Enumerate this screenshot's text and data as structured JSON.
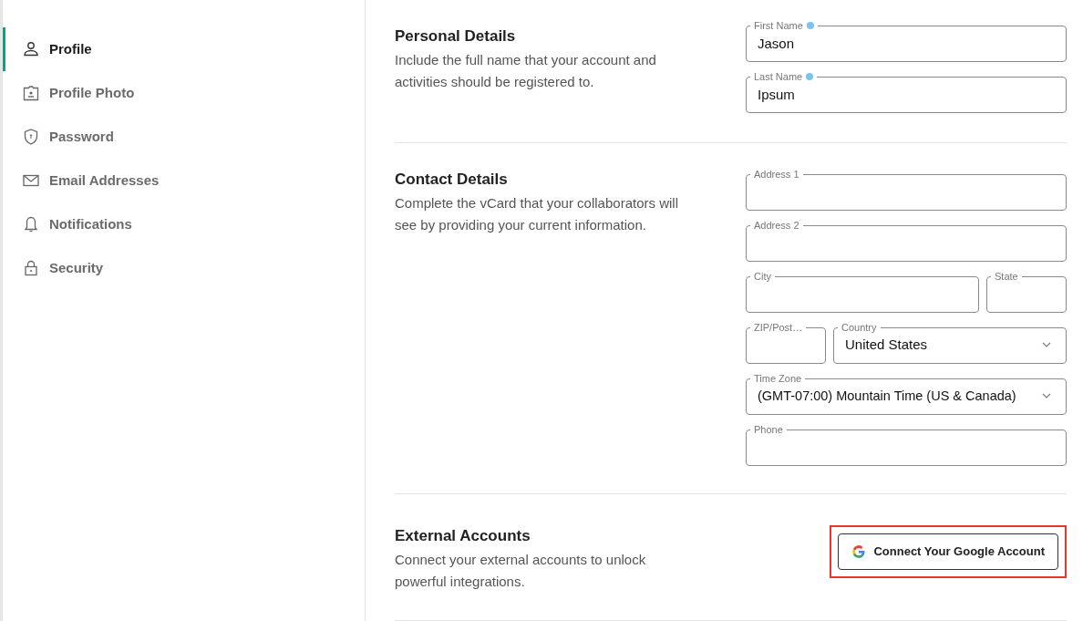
{
  "sidebar": {
    "items": [
      {
        "label": "Profile",
        "selected": true
      },
      {
        "label": "Profile Photo",
        "selected": false
      },
      {
        "label": "Password",
        "selected": false
      },
      {
        "label": "Email Addresses",
        "selected": false
      },
      {
        "label": "Notifications",
        "selected": false
      },
      {
        "label": "Security",
        "selected": false
      }
    ]
  },
  "sections": [
    {
      "title": "Personal Details",
      "description": "Include the full name that your account and activities should be registered to.",
      "rows": [
        [
          {
            "kind": "text",
            "label": "First Name",
            "value": "Jason",
            "required": true
          }
        ],
        [
          {
            "kind": "text",
            "label": "Last Name",
            "value": "Ipsum",
            "required": true
          }
        ]
      ]
    },
    {
      "title": "Contact Details",
      "description": "Complete the vCard that your collaborators will see by providing your current information.",
      "rows": [
        [
          {
            "kind": "text",
            "label": "Address 1",
            "required": false
          }
        ],
        [
          {
            "kind": "text",
            "label": "Address 2",
            "required": false
          }
        ],
        [
          {
            "kind": "text",
            "label": "City",
            "required": false
          },
          {
            "kind": "text",
            "label": "State",
            "required": false
          }
        ],
        [
          {
            "kind": "text",
            "label": "ZIP/Post…",
            "required": false
          },
          {
            "kind": "select",
            "label": "Country",
            "value": "United States",
            "required": false
          }
        ],
        [
          {
            "kind": "select",
            "label": "Time Zone",
            "value": "(GMT-07:00) Mountain Time (US & Canada)",
            "required": false
          }
        ],
        [
          {
            "kind": "text",
            "label": "Phone",
            "required": false
          }
        ]
      ]
    },
    {
      "title": "External Accounts",
      "description": "Connect your external accounts to unlock powerful integrations.",
      "button": {
        "label": "Connect Your Google Account",
        "highlighted": true
      }
    }
  ]
}
